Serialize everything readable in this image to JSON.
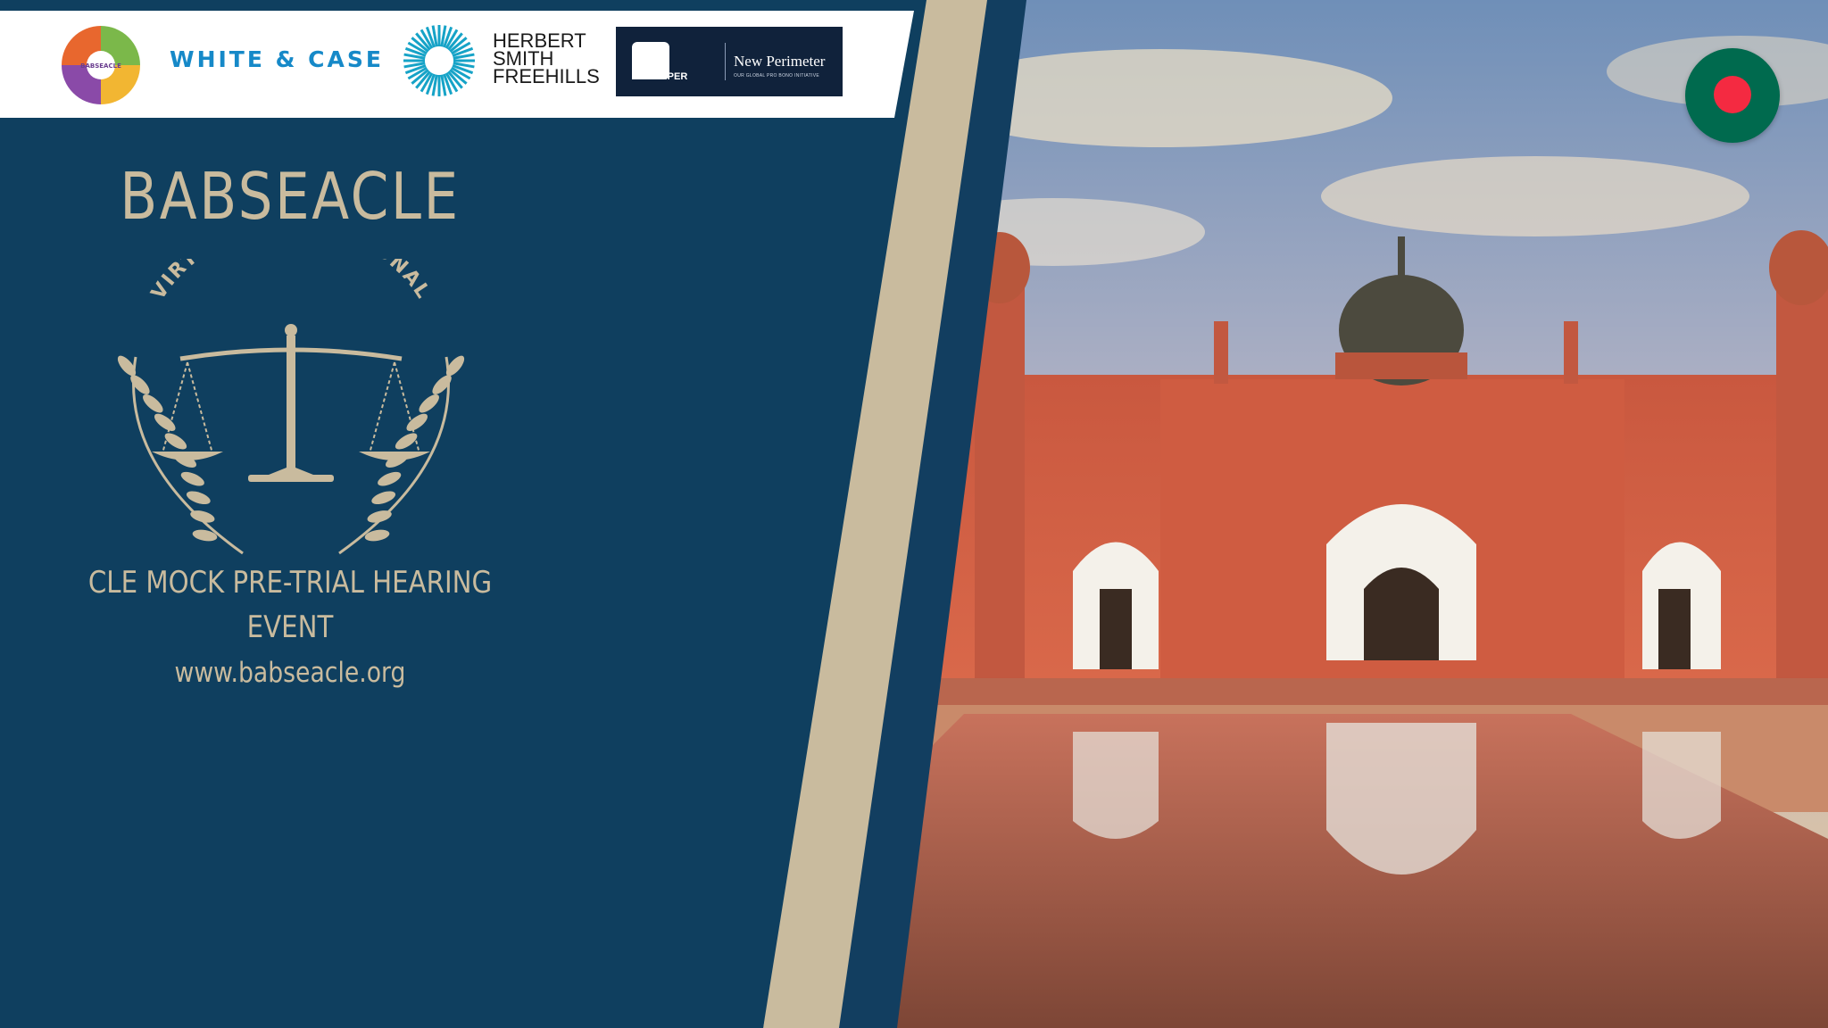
{
  "colors": {
    "panel_navy": "#0f3f5f",
    "accent_beige": "#c9bb9e",
    "stripe_navy": "#123e60",
    "white_case_blue": "#1689c8",
    "flag_green": "#006a4e",
    "flag_red": "#f42a41"
  },
  "header": {
    "partners": {
      "org_logo_caption": "BABSEACLE",
      "white_case": "WHITE & CASE",
      "hsf_line_1": "HERBERT",
      "hsf_line_2": "SMITH",
      "hsf_line_3": "FREEHILLS",
      "dla_name": "DLA PIPER",
      "np_title": "New Perimeter",
      "np_subtitle": "OUR GLOBAL PRO BONO INITIATIVE"
    }
  },
  "panel": {
    "org_name": "BABSEACLE",
    "emblem_arc_text": "VIRTUAL ASIA REGIONAL",
    "event_line_1": "CLE MOCK PRE-TRIAL HEARING",
    "event_line_2": "EVENT",
    "website": "www.babseacle.org"
  },
  "icons": {
    "emblem": "scales-of-justice-icon",
    "flag": "bangladesh-flag-icon",
    "hsf_mark": "sunburst-icon"
  }
}
